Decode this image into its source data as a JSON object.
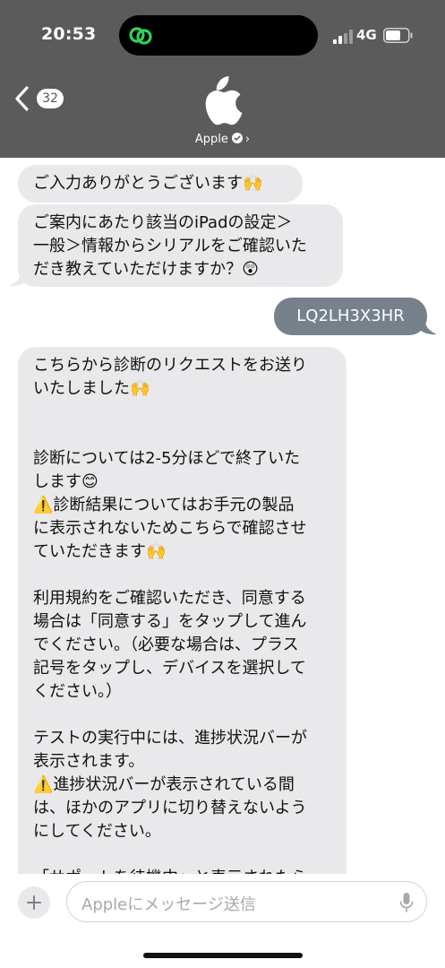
{
  "status_bar": {
    "time": "20:53",
    "network": "4G"
  },
  "header": {
    "back_count": "32",
    "contact_name": "Apple",
    "background_color": "#5b5b5b"
  },
  "messages": [
    {
      "direction": "in",
      "text": "ご入力ありがとうございます🙌"
    },
    {
      "direction": "in",
      "text": "ご案内にあたり該当のiPadの設定＞\n一般＞情報からシリアルをご確認いた\nだき教えていただけますか？😲"
    },
    {
      "direction": "out",
      "text": "LQ2LH3X3HR"
    },
    {
      "direction": "in",
      "text": "こちらから診断のリクエストをお送り\nいたしました🙌\n\n\n診断については2-5分ほどで終了いた\nします😊\n⚠️診断結果についてはお手元の製品\nに表示されないためこちらで確認させ\nていただきます🙌\n\n利用規約をご確認いただき、同意する\n場合は「同意する」をタップして進ん\nでください。（必要な場合は、プラス\n記号をタップし、デバイスを選択して\nください。）\n\nテストの実行中には、進捗状況バーが\n表示されます。\n⚠️進捗状況バーが表示されている間\nは、ほかのアプリに切り替えないよう\nにしてください。\n\n「サポートを待機中」と表示されたら、\nお知らせください。（診断終了しまし"
    }
  ],
  "compose": {
    "placeholder": "Appleにメッセージ送信"
  },
  "colors": {
    "incoming_bubble": "#e9e9eb",
    "outgoing_bubble": "#77818c"
  }
}
